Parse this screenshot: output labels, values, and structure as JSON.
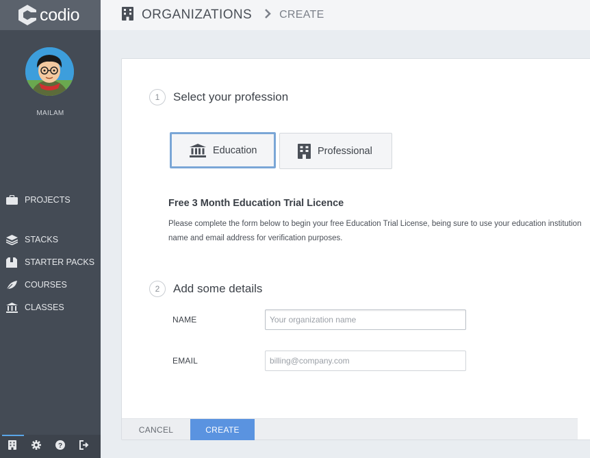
{
  "app": {
    "logo_text": "codio"
  },
  "sidebar": {
    "username": "MAILAM",
    "items": [
      {
        "label": "PROJECTS",
        "icon": "briefcase-icon"
      },
      {
        "label": "STACKS",
        "icon": "stack-icon"
      },
      {
        "label": "STARTER PACKS",
        "icon": "box-icon"
      },
      {
        "label": "COURSES",
        "icon": "courses-icon"
      },
      {
        "label": "CLASSES",
        "icon": "classes-icon"
      }
    ],
    "footer_icons": [
      "building-icon",
      "gear-icon",
      "help-icon",
      "logout-icon"
    ]
  },
  "header": {
    "title": "ORGANIZATIONS",
    "crumb": "CREATE"
  },
  "form": {
    "step1": {
      "number": "1",
      "title": "Select your profession"
    },
    "professions": [
      {
        "label": "Education",
        "selected": true
      },
      {
        "label": "Professional",
        "selected": false
      }
    ],
    "trial_title": "Free 3 Month Education Trial Licence",
    "trial_desc": "Please complete the form below to begin your free Education Trial License, being sure to use your education institution name and email address for verification purposes.",
    "step2": {
      "number": "2",
      "title": "Add some details"
    },
    "name_label": "NAME",
    "name_placeholder": "Your organization name",
    "email_label": "EMAIL",
    "email_placeholder": "billing@company.com",
    "cancel_label": "CANCEL",
    "create_label": "CREATE"
  },
  "colors": {
    "accent": "#5a93e0",
    "sidebar": "#444b55",
    "selected_border": "#7aa6d6"
  }
}
